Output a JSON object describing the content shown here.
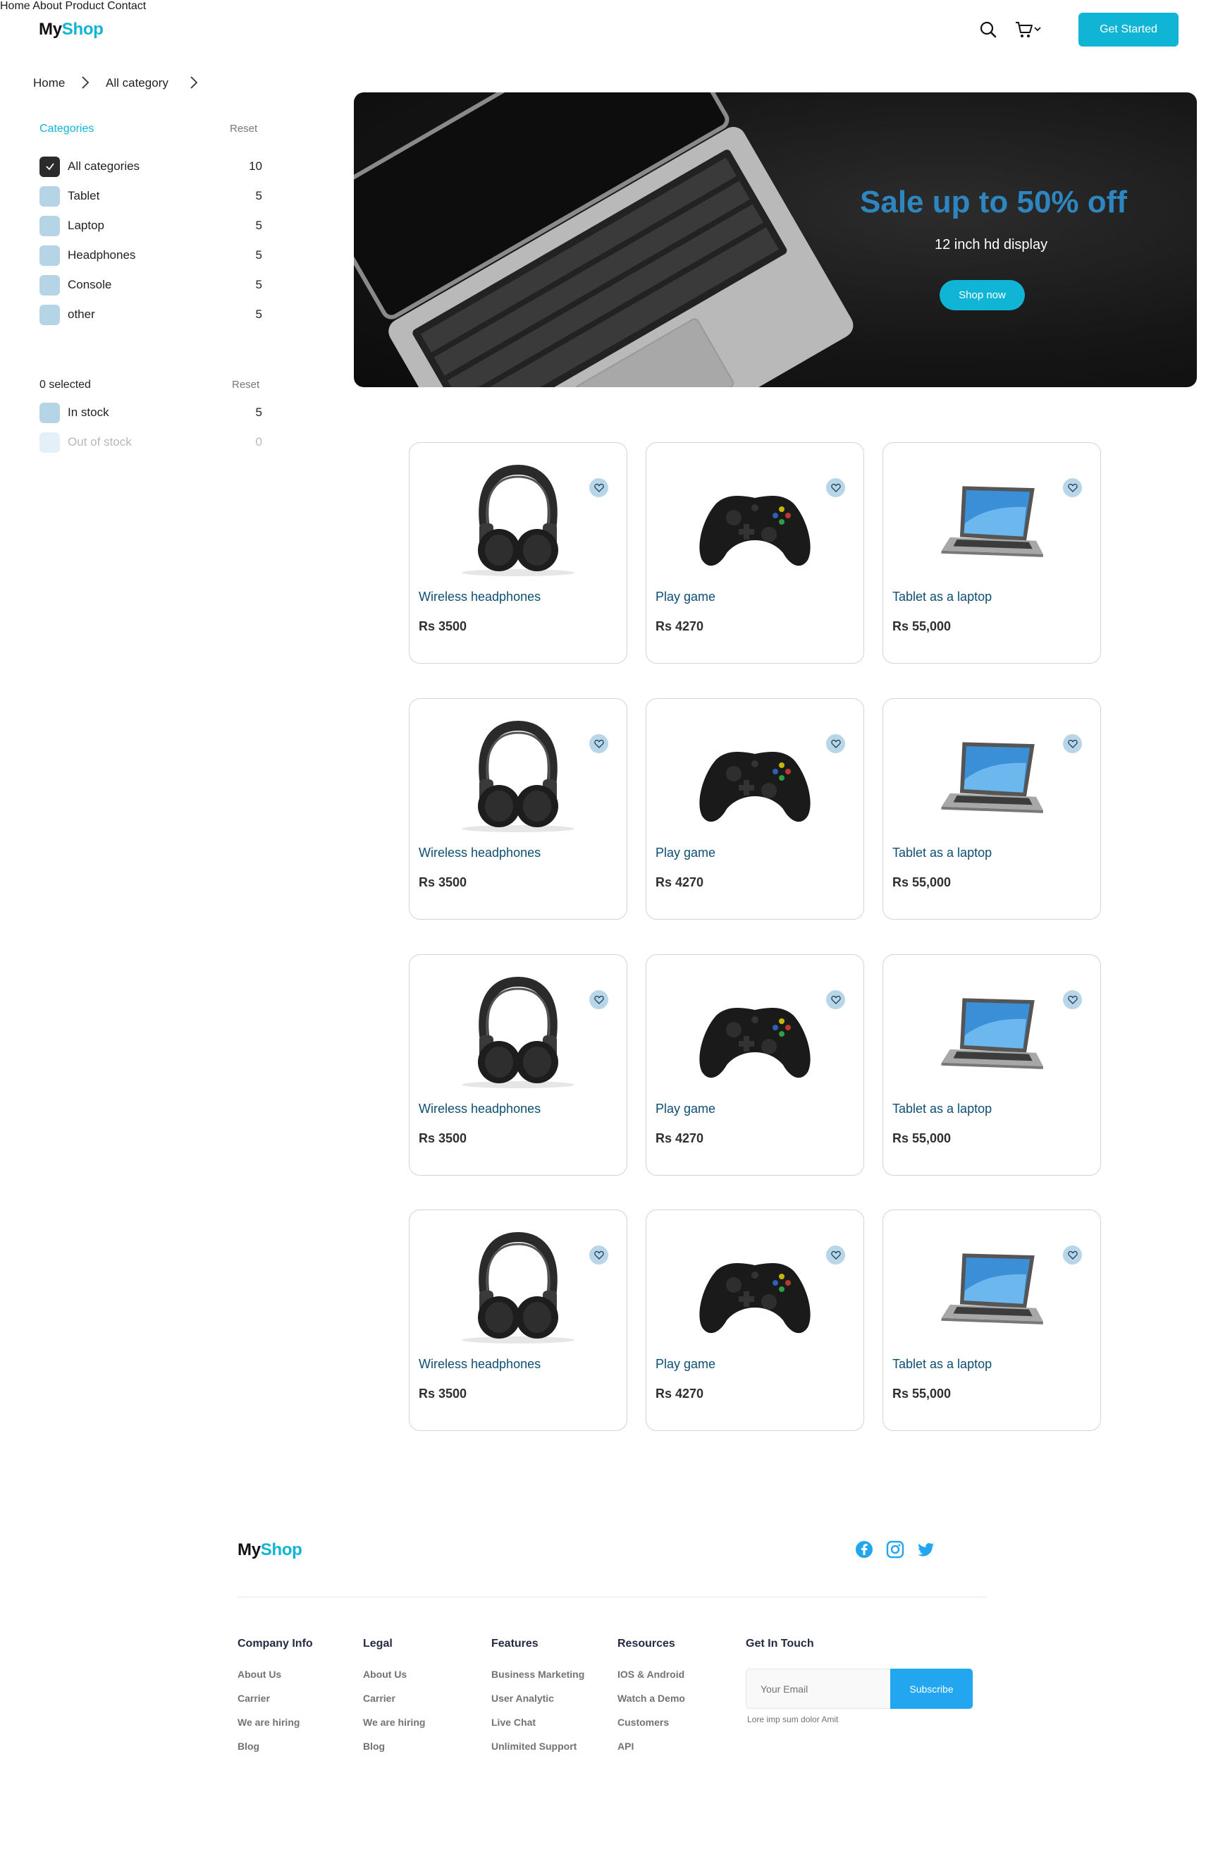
{
  "header": {
    "logo": {
      "part1": "My",
      "part2": "Shop"
    },
    "nav": [
      "Home",
      "About",
      "Product",
      "Contact"
    ],
    "cta": "Get Started"
  },
  "breadcrumb": [
    "Home",
    "All category"
  ],
  "sidebar": {
    "categories": {
      "title": "Categories",
      "reset": "Reset",
      "items": [
        {
          "label": "All categories",
          "count": "10",
          "checked": true
        },
        {
          "label": "Tablet",
          "count": "5",
          "checked": false
        },
        {
          "label": "Laptop",
          "count": "5",
          "checked": false
        },
        {
          "label": "Headphones",
          "count": "5",
          "checked": false
        },
        {
          "label": "Console",
          "count": "5",
          "checked": false
        },
        {
          "label": "other",
          "count": "5",
          "checked": false
        }
      ]
    },
    "stock": {
      "title": "0 selected",
      "reset": "Reset",
      "items": [
        {
          "label": "In stock",
          "count": "5"
        },
        {
          "label": "Out of stock",
          "count": "0"
        }
      ]
    }
  },
  "banner": {
    "headline": "Sale up to 50% off",
    "subline": "12 inch hd display",
    "button": "Shop now"
  },
  "products": [
    {
      "name": "Wireless headphones",
      "price": "Rs 3500",
      "icon": "headphones"
    },
    {
      "name": "Play game",
      "price": "Rs 4270",
      "icon": "game-controller"
    },
    {
      "name": "Tablet as a laptop",
      "price": "Rs 55,000",
      "icon": "laptop"
    },
    {
      "name": "Wireless headphones",
      "price": "Rs 3500",
      "icon": "headphones"
    },
    {
      "name": "Play game",
      "price": "Rs 4270",
      "icon": "game-controller"
    },
    {
      "name": "Tablet as a laptop",
      "price": "Rs 55,000",
      "icon": "laptop"
    },
    {
      "name": "Wireless headphones",
      "price": "Rs 3500",
      "icon": "headphones"
    },
    {
      "name": "Play game",
      "price": "Rs 4270",
      "icon": "game-controller"
    },
    {
      "name": "Tablet as a laptop",
      "price": "Rs 55,000",
      "icon": "laptop"
    },
    {
      "name": "Wireless headphones",
      "price": "Rs 3500",
      "icon": "headphones"
    },
    {
      "name": "Play game",
      "price": "Rs 4270",
      "icon": "game-controller"
    },
    {
      "name": "Tablet as a laptop",
      "price": "Rs 55,000",
      "icon": "laptop"
    }
  ],
  "footer": {
    "logo": {
      "part1": "My",
      "part2": "Shop"
    },
    "social": [
      "facebook",
      "instagram",
      "twitter"
    ],
    "columns": [
      {
        "title": "Company Info",
        "links": [
          "About Us",
          "Carrier",
          "We are hiring",
          "Blog"
        ]
      },
      {
        "title": "Legal",
        "links": [
          "About Us",
          "Carrier",
          "We are hiring",
          "Blog"
        ]
      },
      {
        "title": "Features",
        "links": [
          "Business Marketing",
          "User Analytic",
          "Live Chat",
          "Unlimited Support"
        ]
      },
      {
        "title": "Resources",
        "links": [
          "IOS & Android",
          "Watch a Demo",
          "Customers",
          "API"
        ]
      }
    ],
    "contact": {
      "title": "Get In Touch",
      "email_placeholder": "Your Email",
      "button": "Subscribe",
      "note": "Lore imp sum dolor Amit"
    }
  },
  "colors": {
    "accent": "#10b4d4",
    "banner_headline": "#2e86c1",
    "product_name": "#0e4e72",
    "checkbox": "#b5d4e6",
    "subscribe": "#23a6f0"
  }
}
